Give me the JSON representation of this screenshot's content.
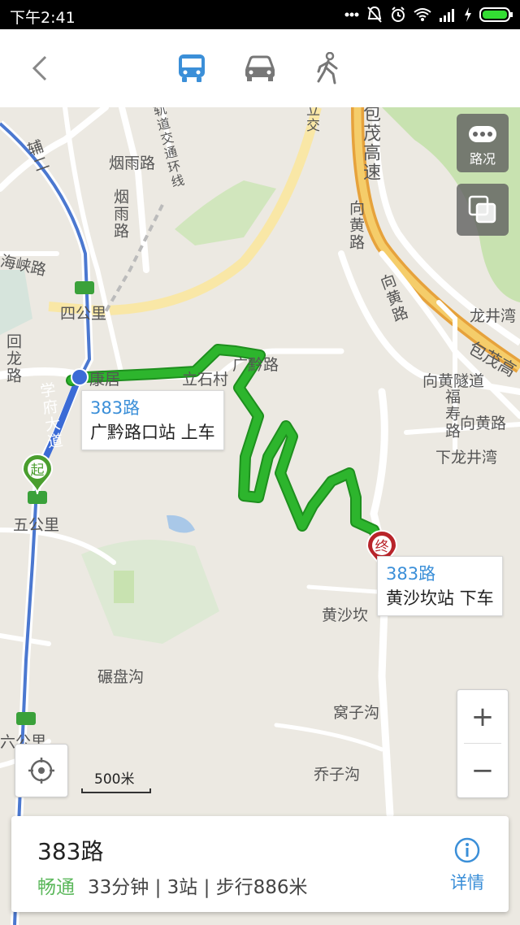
{
  "status_bar": {
    "time": "下午2:41"
  },
  "nav": {
    "modes": [
      {
        "name": "bus",
        "active": true
      },
      {
        "name": "car",
        "active": false
      },
      {
        "name": "walk",
        "active": false
      }
    ],
    "accent": "#3b8fd8"
  },
  "map": {
    "labels": {
      "yanyu_road_h": "烟雨路",
      "yanyu_road_v": "烟雨路",
      "fuer": "辅二",
      "haixia_road": "海峡路",
      "sigongli": "四公里",
      "huilong_road": "回龙路",
      "xuefu_avenue": "学府大道",
      "wugongli": "五公里",
      "liugongli": "六公里",
      "jiaotong_ring": "轨道交通环线",
      "lijiao": "立交",
      "baomao_expressway_v": "包茂高速",
      "xianghuang_road_1": "向黄路",
      "xianghuang_road_2": "向黄路",
      "longjingwan": "龙井湾",
      "baomao_expressway_h": "包茂高",
      "xianghuang_tunnel": "向黄隧道",
      "xianghuang_road_3": "向黄路",
      "fushou_road": "福寿路",
      "xialongjingwan": "下龙井湾",
      "guangqian_road": "广黔路",
      "lishi": "立石村",
      "kangju": "康居",
      "huangshakan": "黄沙坎",
      "nianpangou": "碾盘沟",
      "wozigou": "窝子沟",
      "qiaozigou": "乔子沟"
    },
    "start_marker": "起",
    "end_marker": "终",
    "board": {
      "route": "383路",
      "stop": "广黔路口站 上车"
    },
    "alight": {
      "route": "383路",
      "stop": "黄沙坎站 下车"
    },
    "traffic_label": "路况",
    "scale_text": "500米",
    "zoom_in": "+",
    "zoom_out": "−",
    "route_color": "#2db52d"
  },
  "card": {
    "route_name": "383路",
    "status": "畅通",
    "summary": "33分钟 | 3站 | 步行886米",
    "detail_label": "详情",
    "status_color": "#5cb85c"
  }
}
